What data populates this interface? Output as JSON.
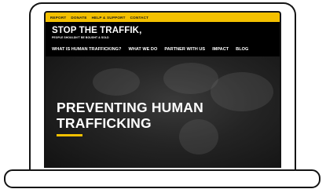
{
  "topbar": {
    "links": [
      "REPORT",
      "DONATE",
      "HELP & SUPPORT",
      "CONTACT"
    ]
  },
  "header": {
    "brand": "STOP THE TRAFFIK",
    "brand_suffix": ",",
    "tagline": "PEOPLE SHOULDN'T BE BOUGHT & SOLD"
  },
  "nav": {
    "items": [
      "WHAT IS HUMAN TRAFFICKING?",
      "WHAT WE DO",
      "PARTNER WITH US",
      "IMPACT",
      "BLOG"
    ]
  },
  "hero": {
    "headline_line1": "PREVENTING HUMAN",
    "headline_line2": "TRAFFICKING"
  },
  "colors": {
    "accent": "#f3c000",
    "header_bg": "#000000",
    "text": "#ffffff"
  }
}
